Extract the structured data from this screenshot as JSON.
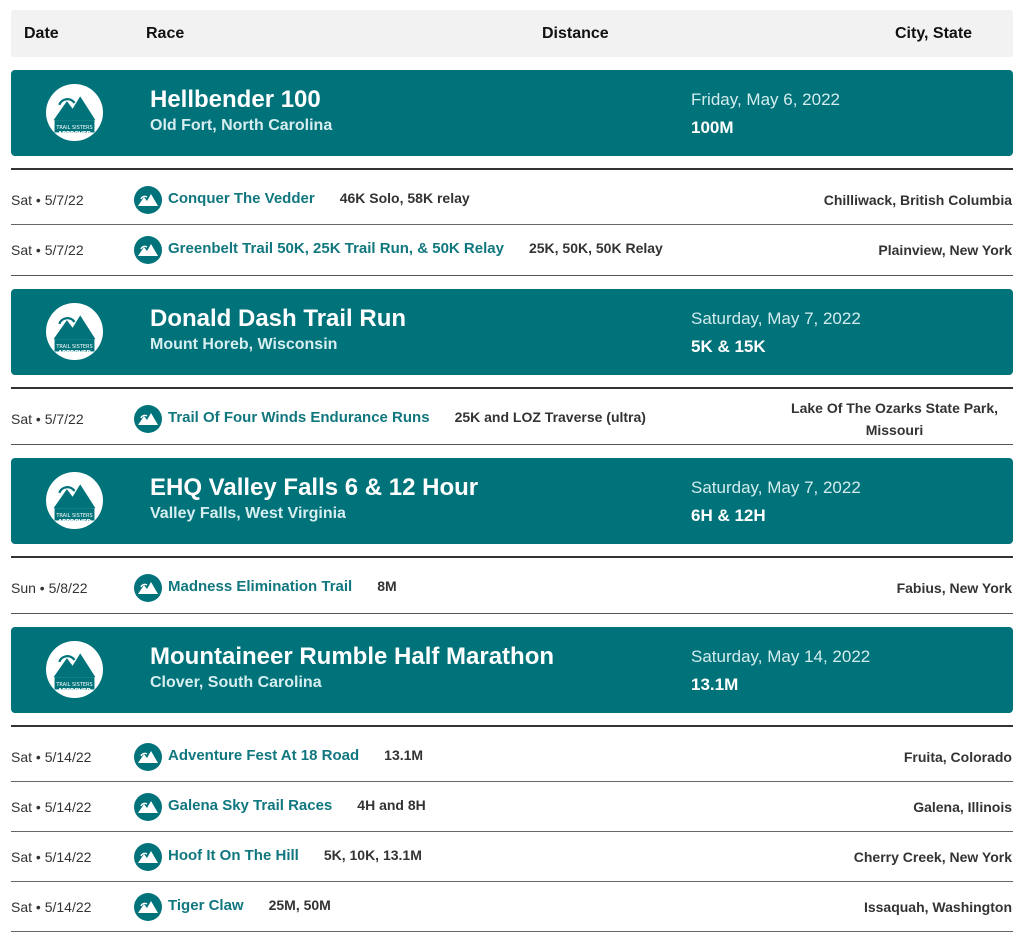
{
  "header": {
    "date": "Date",
    "race": "Race",
    "distance": "Distance",
    "city": "City, State"
  },
  "badge_text": "TRAIL SISTERS APPROVED",
  "colors": {
    "teal": "#00737a",
    "link": "#11777f",
    "header_bg": "#f2f2f2"
  },
  "featured": [
    {
      "name": "Hellbender 100",
      "location": "Old Fort, North Carolina",
      "date": "Friday, May 6, 2022",
      "distance": "100M"
    },
    {
      "name": "Donald Dash Trail Run",
      "location": "Mount Horeb, Wisconsin",
      "date": "Saturday, May 7, 2022",
      "distance": "5K & 15K"
    },
    {
      "name": "EHQ Valley Falls 6 & 12 Hour",
      "location": "Valley Falls, West Virginia",
      "date": "Saturday, May 7, 2022",
      "distance": "6H & 12H"
    },
    {
      "name": "Mountaineer Rumble Half Marathon",
      "location": "Clover, South Carolina",
      "date": "Saturday, May 14, 2022",
      "distance": "13.1M"
    }
  ],
  "races": [
    {
      "date": "Sat • 5/7/22",
      "name": "Conquer The Vedder",
      "distance": "46K Solo, 58K relay",
      "city": "Chilliwack, British Columbia"
    },
    {
      "date": "Sat • 5/7/22",
      "name": "Greenbelt Trail 50K, 25K Trail Run, & 50K Relay",
      "distance": "25K, 50K, 50K Relay",
      "city": "Plainview, New York"
    },
    {
      "date": "Sat • 5/7/22",
      "name": "Trail Of Four Winds Endurance Runs",
      "distance": "25K and LOZ Traverse (ultra)",
      "city_line1": "Lake Of The Ozarks State Park,",
      "city_line2": "Missouri"
    },
    {
      "date": "Sun • 5/8/22",
      "name": "Madness Elimination Trail",
      "distance": "8M",
      "city": "Fabius, New York"
    },
    {
      "date": "Sat • 5/14/22",
      "name": "Adventure Fest At 18 Road",
      "distance": "13.1M",
      "city": "Fruita, Colorado"
    },
    {
      "date": "Sat • 5/14/22",
      "name": "Galena Sky Trail Races",
      "distance": "4H and 8H",
      "city": "Galena, Illinois"
    },
    {
      "date": "Sat • 5/14/22",
      "name": "Hoof It On The Hill",
      "distance": "5K, 10K, 13.1M",
      "city": "Cherry Creek, New York"
    },
    {
      "date": "Sat • 5/14/22",
      "name": "Tiger Claw",
      "distance": "25M, 50M",
      "city": "Issaquah, Washington"
    }
  ]
}
